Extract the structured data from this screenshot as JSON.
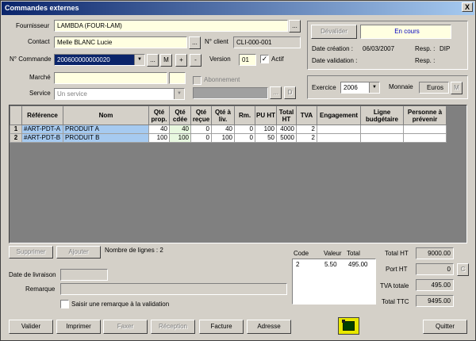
{
  "window": {
    "title": "Commandes externes",
    "close": "X"
  },
  "header": {
    "fournisseur_label": "Fournisseur",
    "fournisseur_value": "LAMBDA (FOUR-LAM)",
    "contact_label": "Contact",
    "contact_value": "Melle BLANC Lucie",
    "nclient_label": "N° client",
    "nclient_value": "CLI-000-001",
    "ncommande_label": "N° Commande",
    "ncommande_value": "200600000000020",
    "version_label": "Version",
    "version_value": "01",
    "actif_label": "Actif",
    "marche_label": "Marché",
    "service_label": "Service",
    "service_placeholder": "Un service",
    "abonnement_label": "Abonnement",
    "ellipsis": "...",
    "m": "M",
    "plus": "+",
    "minus": "-",
    "d": "D"
  },
  "status": {
    "devalider_label": "Dévalider",
    "status_value": "En cours",
    "creation_label": "Date création :",
    "creation_value": "06/03/2007",
    "resp_label": "Resp. :",
    "resp_value": "DIP",
    "validation_label": "Date validation :",
    "resp2_label": "Resp. :",
    "exercice_label": "Exercice",
    "exercice_value": "2006",
    "monnaie_label": "Monnaie",
    "monnaie_value": "Euros",
    "m": "M"
  },
  "grid": {
    "columns": [
      "Référence",
      "Nom",
      "Qté prop.",
      "Qté cdée",
      "Qté reçue",
      "Qté à liv.",
      "Rm.",
      "PU HT",
      "Total HT",
      "TVA",
      "Engagement",
      "Ligne budgétaire",
      "Personne à prévenir"
    ],
    "rows": [
      {
        "n": "1",
        "ref": "#ART-PDT-A",
        "nom": "PRODUIT A",
        "prop": "40",
        "cdee": "40",
        "recue": "0",
        "aliv": "40",
        "rm": "0",
        "pu": "100",
        "total": "4000",
        "tva": "2"
      },
      {
        "n": "2",
        "ref": "#ART-PDT-B",
        "nom": "PRODUIT B",
        "prop": "100",
        "cdee": "100",
        "recue": "0",
        "aliv": "100",
        "rm": "0",
        "pu": "50",
        "total": "5000",
        "tva": "2"
      }
    ]
  },
  "below_grid": {
    "supprimer": "Supprimer",
    "ajouter": "Ajouter",
    "nb_lignes": "Nombre de lignes : 2",
    "date_livraison_label": "Date de livraison",
    "remarque_label": "Remarque",
    "saisir_label": "Saisir une remarque à la validation"
  },
  "vat": {
    "headers": [
      "Code",
      "Valeur",
      "Total"
    ],
    "rows": [
      {
        "code": "2",
        "valeur": "5.50",
        "total": "495.00"
      }
    ]
  },
  "totals": {
    "total_ht_label": "Total HT",
    "total_ht_value": "9000.00",
    "port_ht_label": "Port HT",
    "port_ht_value": "0",
    "c": "C",
    "tva_totale_label": "TVA totale",
    "tva_totale_value": "495.00",
    "total_ttc_label": "Total TTC",
    "total_ttc_value": "9495.00"
  },
  "footer": {
    "valider": "Valider",
    "imprimer": "Imprimer",
    "faxer": "Faxer",
    "reception": "Réception",
    "facture": "Facture",
    "adresse": "Adresse",
    "quitter": "Quitter"
  }
}
